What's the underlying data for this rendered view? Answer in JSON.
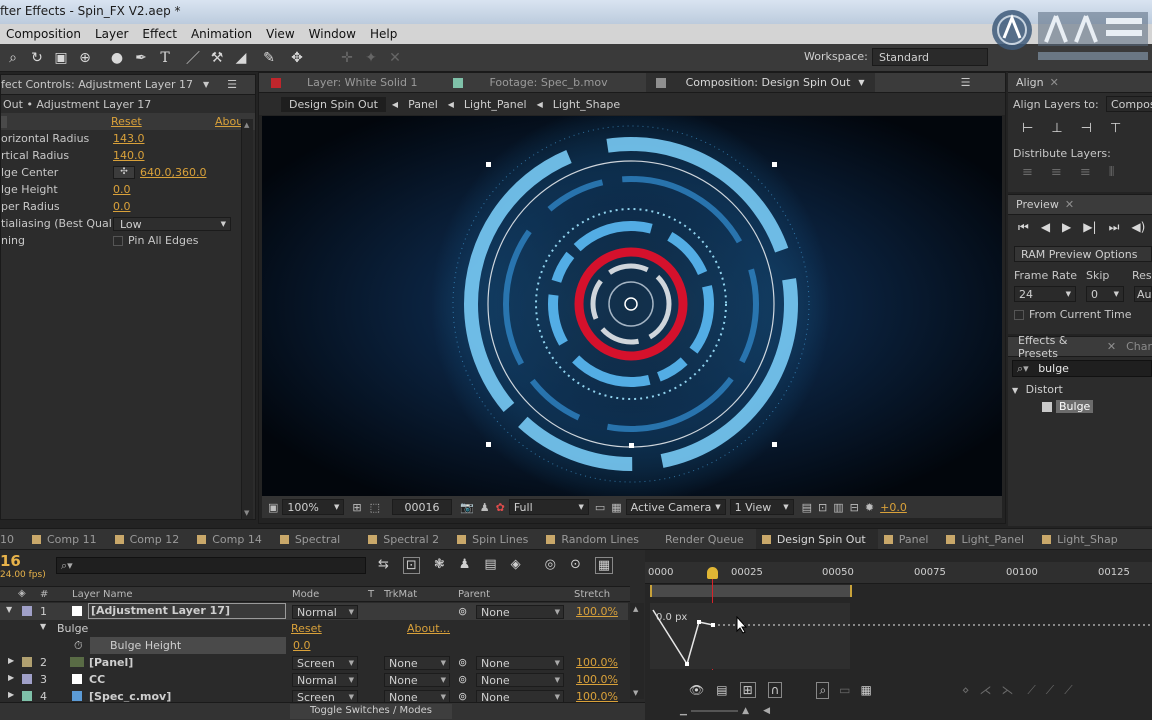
{
  "window": {
    "title": "fter Effects - Spin_FX V2.aep *"
  },
  "menu": [
    "Composition",
    "Layer",
    "Effect",
    "Animation",
    "View",
    "Window",
    "Help"
  ],
  "toolbar": {
    "workspace_label": "Workspace:",
    "workspace_value": "Standard"
  },
  "effect_controls": {
    "tab_label": "fect Controls: Adjustment Layer 17",
    "path": "Out • Adjustment Layer 17",
    "reset_label": "Reset",
    "about_label": "Abou",
    "rows": [
      {
        "label": "orizontal Radius",
        "value": "143.0"
      },
      {
        "label": "rtical Radius",
        "value": "140.0"
      },
      {
        "label": "lge Center",
        "value": "640.0,360.0"
      },
      {
        "label": "lge Height",
        "value": "0.0"
      },
      {
        "label": "per Radius",
        "value": "0.0"
      },
      {
        "label": "tialiasing (Best Qual C",
        "value": "Low"
      },
      {
        "label": "ning",
        "value": "Pin All Edges"
      }
    ]
  },
  "viewer_tabs": [
    {
      "label": "Layer: White Solid 1"
    },
    {
      "label": "Footage: Spec_b.mov"
    },
    {
      "label": "Composition: Design Spin Out"
    }
  ],
  "breadcrumbs": [
    "Design Spin Out",
    "Panel",
    "Light_Panel",
    "Light_Shape"
  ],
  "viewer_footer": {
    "zoom": "100%",
    "timecode": "00016",
    "resolution": "Full",
    "camera": "Active Camera",
    "views": "1 View",
    "exposure": "+0.0"
  },
  "align": {
    "title": "Align",
    "align_to_label": "Align Layers to:",
    "align_to_value": "Composi",
    "distribute_label": "Distribute Layers:"
  },
  "preview": {
    "title": "Preview",
    "ram_label": "RAM Preview Options",
    "frame_rate_label": "Frame Rate",
    "skip_label": "Skip",
    "res_label": "Res",
    "frame_rate_value": "24",
    "skip_value": "0",
    "res_value": "Au",
    "from_current": "From Current Time"
  },
  "effects_presets": {
    "title": "Effects & Presets",
    "char_tab": "Char",
    "search": "bulge",
    "category": "Distort",
    "item": "Bulge"
  },
  "timeline_tabs": [
    "10",
    "Comp 11",
    "Comp 12",
    "Comp 14",
    "Spectral",
    "Spectral 2",
    "Spin Lines",
    "Random Lines",
    "Render Queue",
    "Design Spin Out",
    "Panel",
    "Light_Panel",
    "Light_Shap"
  ],
  "timeline": {
    "current_time": "16",
    "fps": "24.00 fps)",
    "columns": {
      "hash": "#",
      "layer_name": "Layer Name",
      "mode": "Mode",
      "t": "T",
      "trkmat": "TrkMat",
      "parent": "Parent",
      "stretch": "Stretch"
    },
    "ruler": [
      "0000",
      "00025",
      "00050",
      "00075",
      "00100",
      "00125"
    ],
    "graph_value": "0.0 px",
    "toggle_label": "Toggle Switches / Modes",
    "layers": [
      {
        "num": "1",
        "name": "[Adjustment Layer 17]",
        "mode": "Normal",
        "trkmat": "",
        "parent": "None",
        "stretch": "100.0%",
        "color": "#ffffff"
      },
      {
        "num": "2",
        "name": "[Panel]",
        "mode": "Screen",
        "trkmat": "None",
        "parent": "None",
        "stretch": "100.0%",
        "color": "#b0a070"
      },
      {
        "num": "3",
        "name": "CC",
        "mode": "Normal",
        "trkmat": "None",
        "parent": "None",
        "stretch": "100.0%",
        "color": "#ffffff"
      },
      {
        "num": "4",
        "name": "[Spec_c.mov]",
        "mode": "Screen",
        "trkmat": "None",
        "parent": "None",
        "stretch": "100.0%",
        "color": "#5c9bd6"
      }
    ],
    "effect_group": {
      "name": "Bulge",
      "reset": "Reset",
      "about": "About..."
    },
    "property": {
      "name": "Bulge Height",
      "value": "0.0"
    }
  }
}
